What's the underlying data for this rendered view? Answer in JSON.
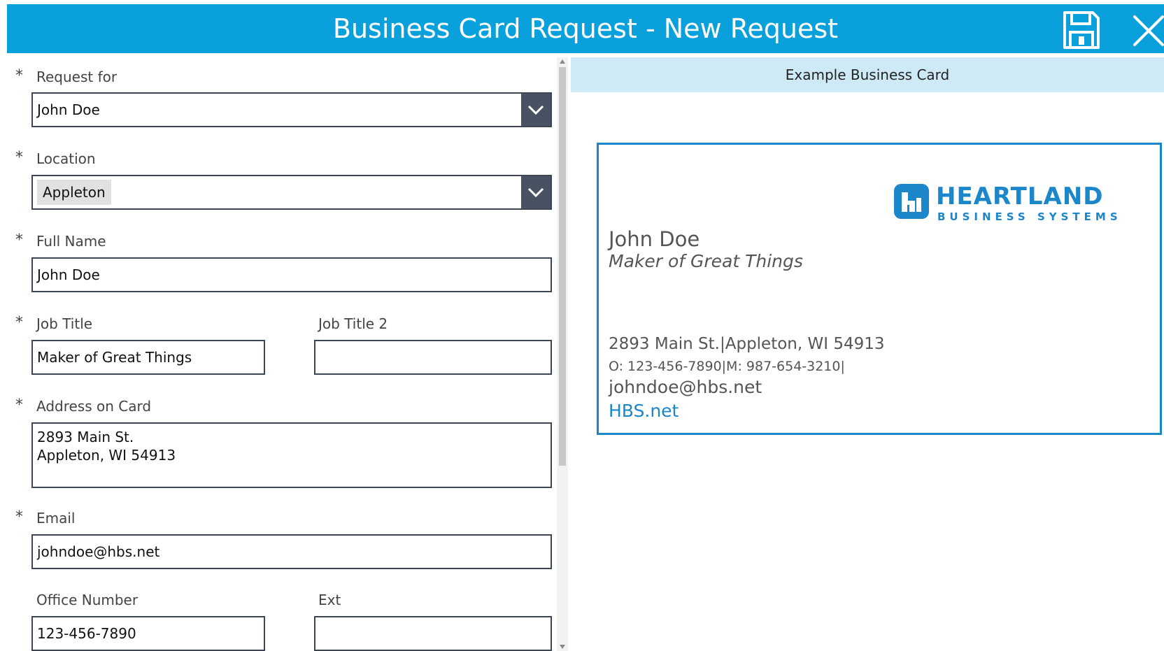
{
  "header": {
    "title": "Business Card Request - New Request",
    "save_icon": "save-icon",
    "close_icon": "close-icon",
    "color": "#0aa0dc"
  },
  "form": {
    "request_for": {
      "label": "Request for",
      "required": "*",
      "value": "John Doe"
    },
    "location": {
      "label": "Location",
      "required": "*",
      "value": "Appleton"
    },
    "full_name": {
      "label": "Full Name",
      "required": "*",
      "value": "John Doe"
    },
    "job_title": {
      "label": "Job Title",
      "required": "*",
      "value": "Maker of Great Things"
    },
    "job_title_2": {
      "label": "Job Title 2",
      "value": ""
    },
    "address": {
      "label": "Address on Card",
      "required": "*",
      "value": "2893 Main St.\nAppleton, WI 54913"
    },
    "email": {
      "label": "Email",
      "required": "*",
      "value": "johndoe@hbs.net"
    },
    "office_number": {
      "label": "Office Number",
      "value": "123-456-7890"
    },
    "ext": {
      "label": "Ext",
      "value": ""
    }
  },
  "preview": {
    "header": "Example Business Card",
    "card": {
      "logo_word": "HEARTLAND",
      "logo_sub": "BUSINESS SYSTEMS",
      "name": "John Doe",
      "title": "Maker of Great Things",
      "address": "2893 Main St.|Appleton, WI 54913",
      "phones": "O: 123-456-7890|M: 987-654-3210|",
      "email": "johndoe@hbs.net",
      "website": "HBS.net",
      "border_color": "#1b86c9"
    }
  }
}
